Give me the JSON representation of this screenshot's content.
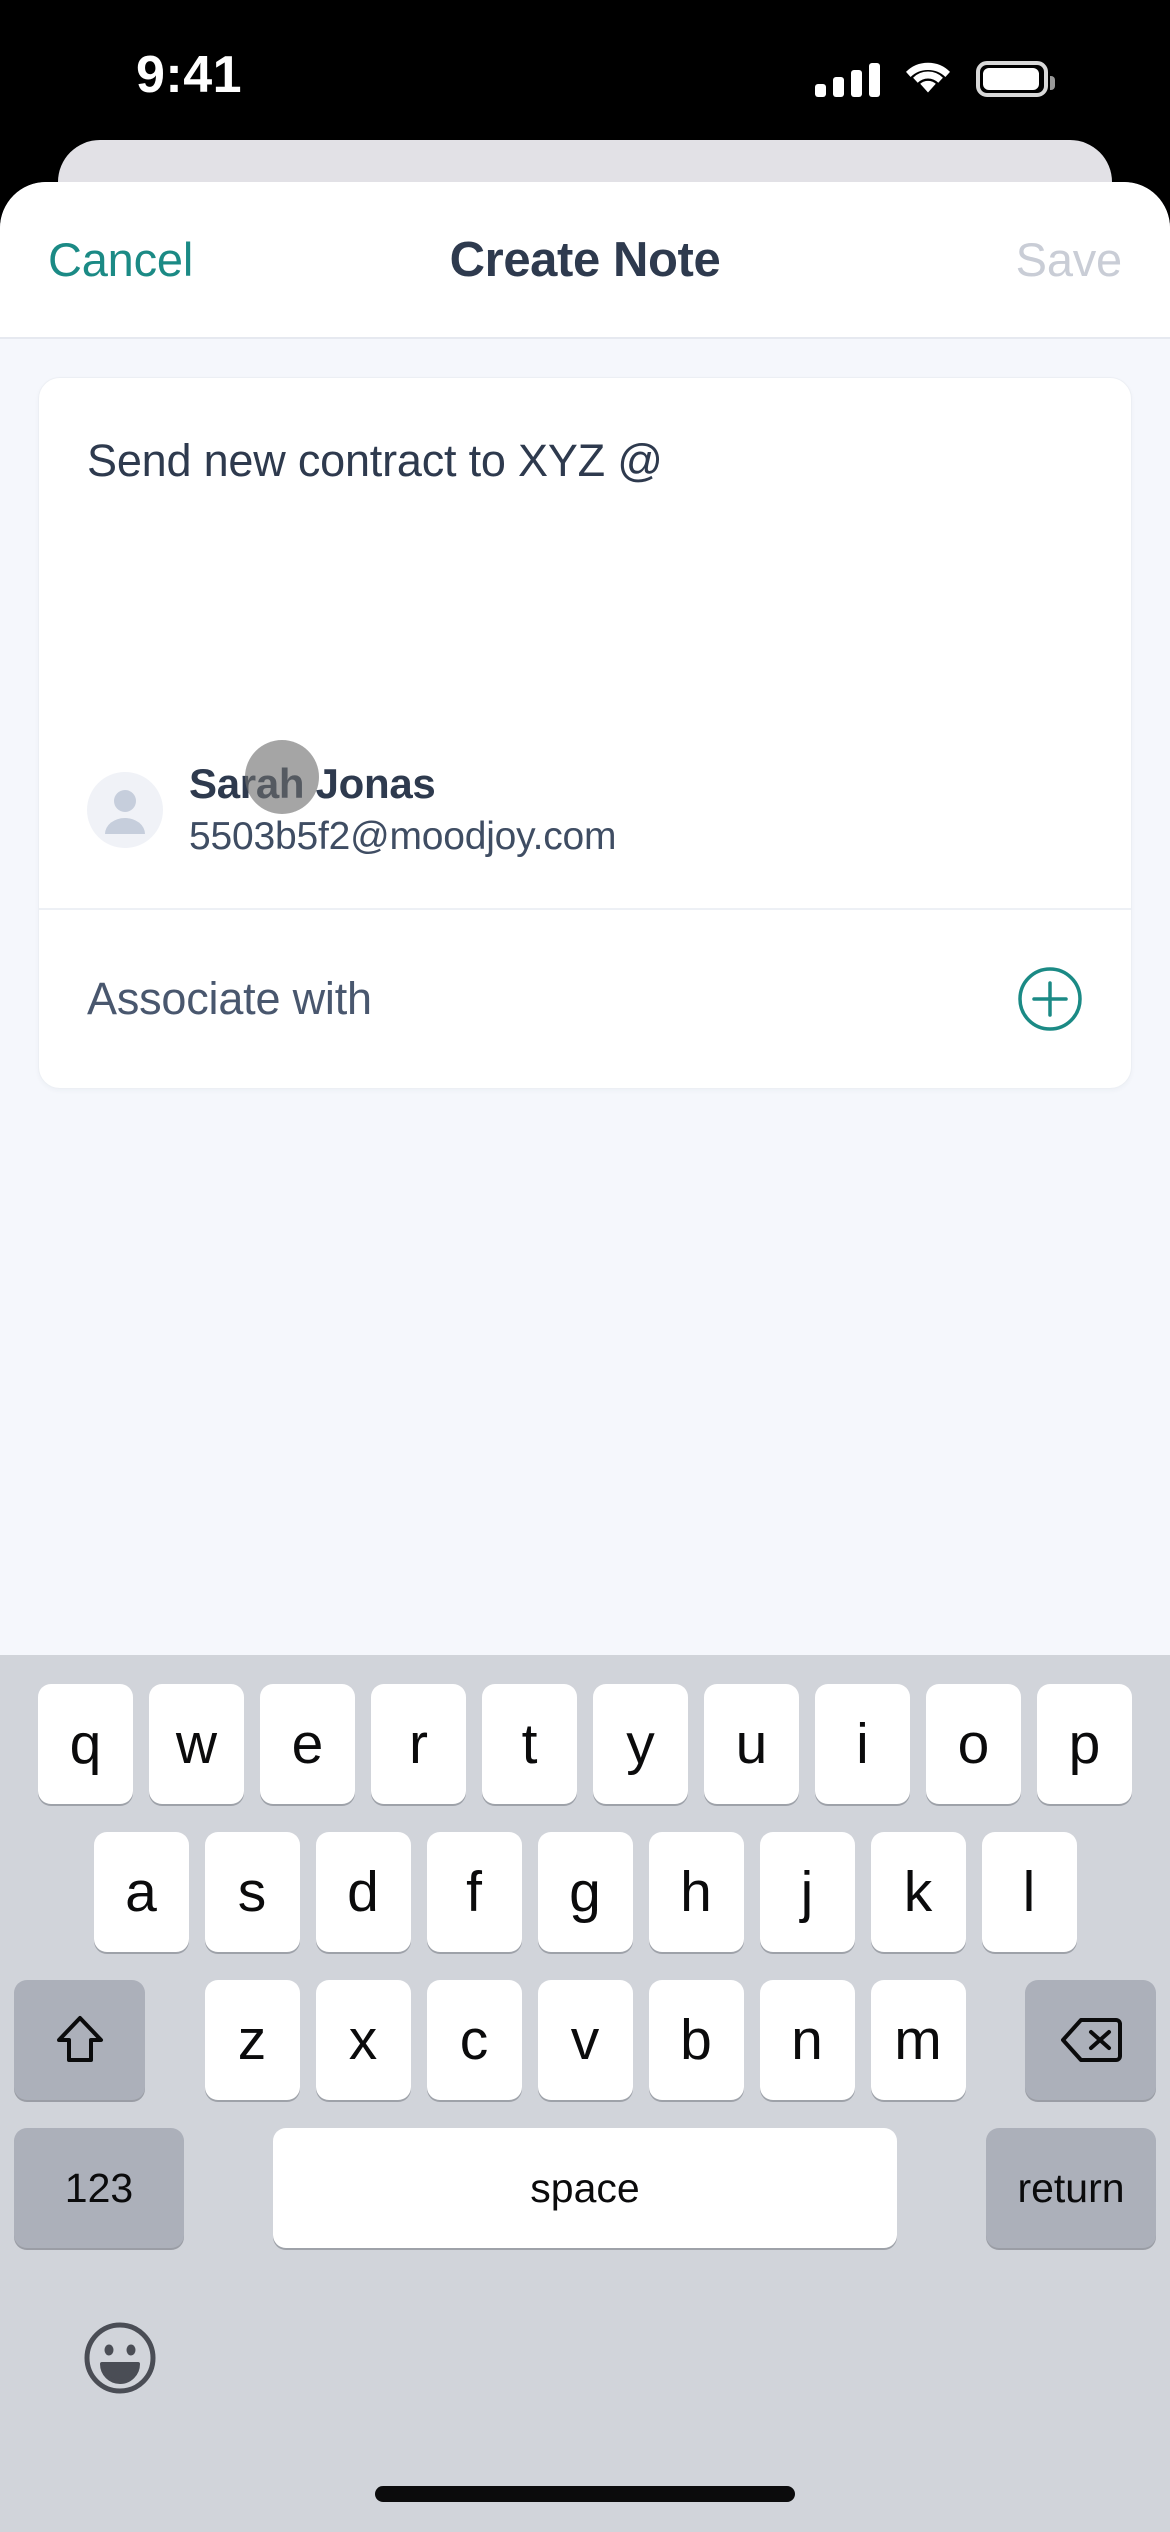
{
  "status_bar": {
    "time": "9:41",
    "cellular_icon": "cellular-signal-icon",
    "wifi_icon": "wifi-icon",
    "battery_icon": "battery-icon"
  },
  "nav": {
    "cancel_label": "Cancel",
    "title": "Create Note",
    "save_label": "Save",
    "save_enabled": false
  },
  "note": {
    "text": "Send new contract to XYZ @"
  },
  "mention_suggestion": {
    "avatar_icon": "person-avatar-icon",
    "name": "Sarah Jonas",
    "email": "5503b5f2@moodjoy.com"
  },
  "associate": {
    "label": "Associate with",
    "add_icon": "plus-circle-icon"
  },
  "keyboard": {
    "row1": [
      "q",
      "w",
      "e",
      "r",
      "t",
      "y",
      "u",
      "i",
      "o",
      "p"
    ],
    "row2": [
      "a",
      "s",
      "d",
      "f",
      "g",
      "h",
      "j",
      "k",
      "l"
    ],
    "row3": [
      "z",
      "x",
      "c",
      "v",
      "b",
      "n",
      "m"
    ],
    "shift_icon": "shift-arrow-icon",
    "backspace_icon": "backspace-delete-icon",
    "numeric_label": "123",
    "space_label": "space",
    "return_label": "return",
    "emoji_icon": "emoji-smiley-icon"
  },
  "colors": {
    "accent_teal": "#1B8A85",
    "title_navy": "#2E3A4E",
    "disabled_gray": "#C9CDD6",
    "page_background": "#F5F7FC",
    "card_white": "#FFFFFF",
    "keyboard_background": "#D1D4DA",
    "key_dark": "#ACB0BA",
    "status_bar_background": "#000000"
  }
}
